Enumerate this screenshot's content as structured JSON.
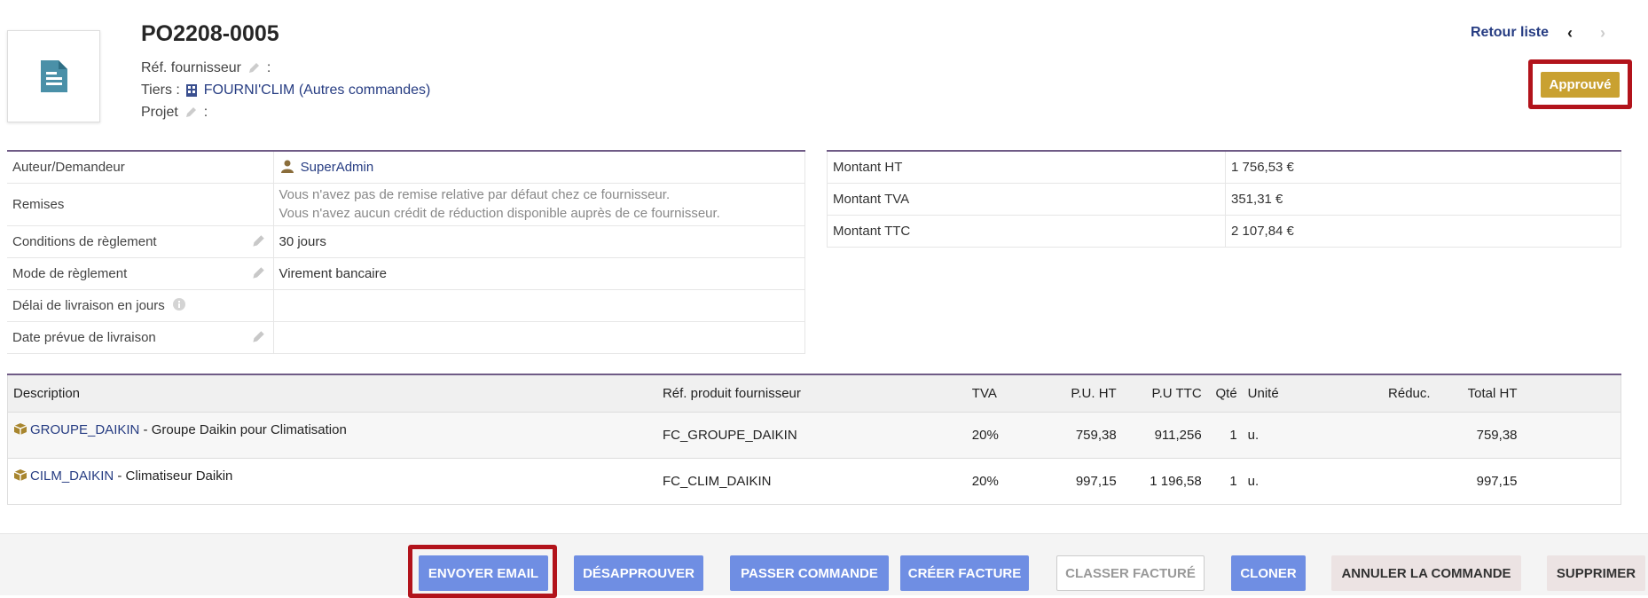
{
  "header": {
    "ref": "PO2208-0005",
    "ref_supplier_label": "Réf. fournisseur",
    "colon": ":",
    "tiers_label": "Tiers :",
    "tiers_name": "FOURNI'CLIM",
    "tiers_other": "(Autres commandes)",
    "project_label": "Projet",
    "back_to_list": "Retour liste",
    "prev_arrow": "‹",
    "next_arrow": "›",
    "status": "Approuvé",
    "status_color": "#c9a131"
  },
  "info_left": {
    "author_label": "Auteur/Demandeur",
    "author_value": "SuperAdmin",
    "discounts_label": "Remises",
    "discounts_line1": "Vous n'avez pas de remise relative par défaut chez ce fournisseur.",
    "discounts_line2": "Vous n'avez aucun crédit de réduction disponible auprès de ce fournisseur.",
    "payment_terms_label": "Conditions de règlement",
    "payment_terms_value": "30 jours",
    "payment_mode_label": "Mode de règlement",
    "payment_mode_value": "Virement bancaire",
    "delivery_delay_label": "Délai de livraison en jours",
    "delivery_delay_value": "",
    "delivery_date_label": "Date prévue de livraison",
    "delivery_date_value": ""
  },
  "info_right": {
    "amount_ht_label": "Montant HT",
    "amount_ht_value": "1 756,53 €",
    "amount_tva_label": "Montant TVA",
    "amount_tva_value": "351,31 €",
    "amount_ttc_label": "Montant TTC",
    "amount_ttc_value": "2 107,84 €"
  },
  "lines": {
    "headers": {
      "description": "Description",
      "ref_supplier": "Réf. produit fournisseur",
      "tva": "TVA",
      "pu_ht": "P.U. HT",
      "pu_ttc": "P.U TTC",
      "qty": "Qté",
      "unit": "Unité",
      "discount": "Réduc.",
      "total_ht": "Total HT"
    },
    "rows": [
      {
        "code": "GROUPE_DAIKIN",
        "label": " - Groupe Daikin pour Climatisation",
        "ref": "FC_GROUPE_DAIKIN",
        "tva": "20%",
        "pu_ht": "759,38",
        "pu_ttc": "911,256",
        "qty": "1",
        "unit": "u.",
        "discount": "",
        "total_ht": "759,38"
      },
      {
        "code": "CILM_DAIKIN",
        "label": " - Climatiseur Daikin",
        "ref": "FC_CLIM_DAIKIN",
        "tva": "20%",
        "pu_ht": "997,15",
        "pu_ttc": "1 196,58",
        "qty": "1",
        "unit": "u.",
        "discount": "",
        "total_ht": "997,15"
      }
    ]
  },
  "actions": {
    "send_email": "ENVOYER EMAIL",
    "disapprove": "DÉSAPPROUVER",
    "place_order": "PASSER COMMANDE",
    "create_invoice": "CRÉER FACTURE",
    "classify_billed": "CLASSER FACTURÉ",
    "clone": "CLONER",
    "cancel_order": "ANNULER LA COMMANDE",
    "delete": "SUPPRIMER"
  },
  "colors": {
    "accent_line": "#6f5b86",
    "button_blue": "#6f8ee3",
    "highlight_red": "#b2131b",
    "link": "#263c82"
  }
}
